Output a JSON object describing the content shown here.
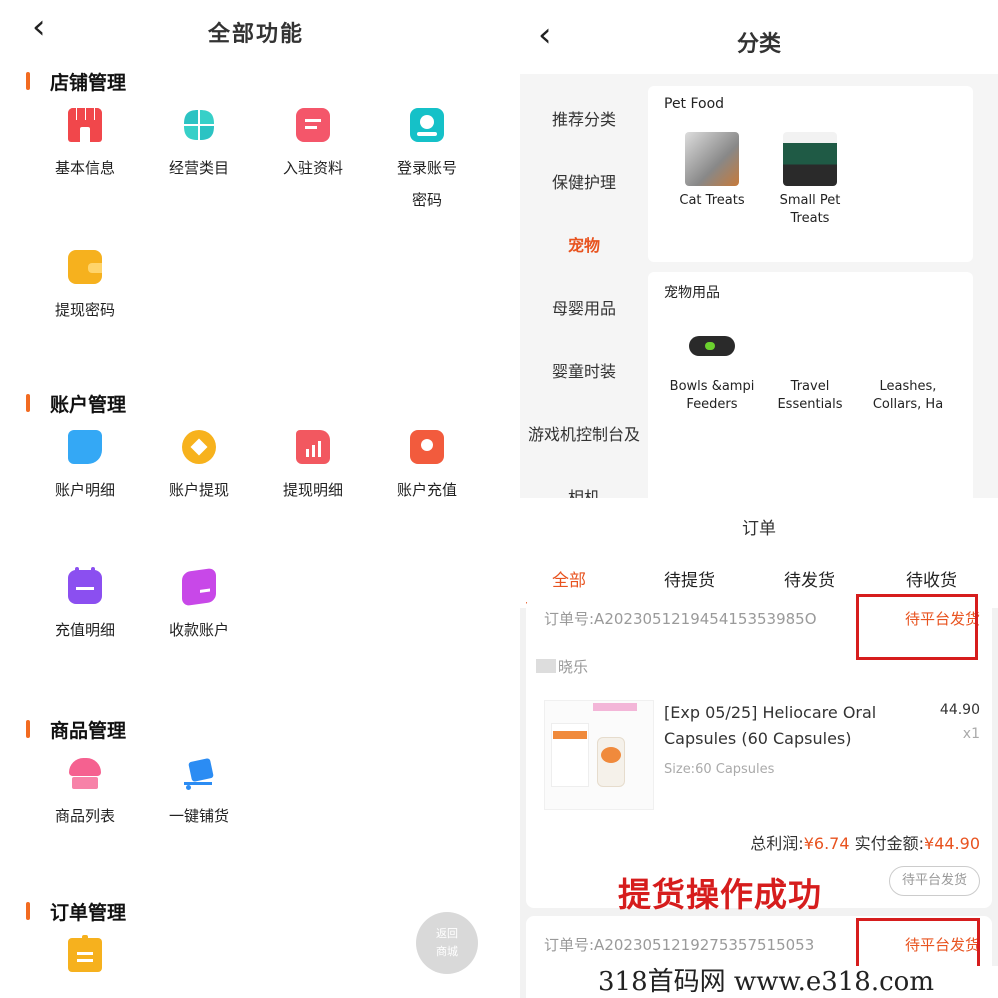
{
  "left": {
    "title": "全部功能",
    "back_icon": "chevron-left-icon",
    "return_button": {
      "line1": "返回",
      "line2": "商城"
    },
    "sections": [
      {
        "title": "店铺管理",
        "items": [
          {
            "label": "基本信息",
            "icon": "store-icon",
            "color": "#f1474b"
          },
          {
            "label": "经营类目",
            "icon": "category-icon",
            "color": "#2cc3c3"
          },
          {
            "label": "入驻资料",
            "icon": "document-icon",
            "color": "#f4566a"
          },
          {
            "label": "登录账号\n密码",
            "icon": "account-icon",
            "color": "#15c1c8"
          },
          {
            "label": "提现密码",
            "icon": "wallet-icon",
            "color": "#f6b11e"
          }
        ]
      },
      {
        "title": "账户管理",
        "items": [
          {
            "label": "账户明细",
            "icon": "account-detail-icon",
            "color": "#34a8f5"
          },
          {
            "label": "账户提现",
            "icon": "withdraw-icon",
            "color": "#f7b21d"
          },
          {
            "label": "提现明细",
            "icon": "folder-chart-icon",
            "color": "#f25860"
          },
          {
            "label": "账户充值",
            "icon": "recharge-icon",
            "color": "#f25b3d"
          },
          {
            "label": "充值明细",
            "icon": "calendar-icon",
            "color": "#8b4ff0"
          },
          {
            "label": "收款账户",
            "icon": "card-icon",
            "color": "#c848e8"
          }
        ]
      },
      {
        "title": "商品管理",
        "items": [
          {
            "label": "商品列表",
            "icon": "cake-icon",
            "color": "#f56190"
          },
          {
            "label": "一键铺货",
            "icon": "cart-box-icon",
            "color": "#2b8cf3"
          }
        ]
      },
      {
        "title": "订单管理",
        "items": [
          {
            "label": "",
            "icon": "clipboard-icon",
            "color": "#f6b11e"
          }
        ]
      }
    ]
  },
  "category": {
    "title": "分类",
    "sidebar": [
      "推荐分类",
      "保健护理",
      "宠物",
      "母婴用品",
      "婴童时装",
      "游戏机控制台及",
      "相机"
    ],
    "active": "宠物",
    "groups": [
      {
        "title": "Pet Food",
        "items": [
          "Cat Treats",
          "Small Pet\nTreats"
        ]
      },
      {
        "title": "宠物用品",
        "items": [
          "Bowls &ampi\nFeeders",
          "Travel\nEssentials",
          "Leashes,\nCollars, Ha"
        ]
      }
    ]
  },
  "orders": {
    "title": "订单",
    "tabs": [
      "全部",
      "待提货",
      "待发货",
      "待收货"
    ],
    "active_tab": "全部",
    "order1": {
      "number": "订单号:A202305121945415353985O",
      "status": "待平台发货",
      "shop": "晓乐",
      "product": "[Exp 05/25] Heliocare Oral Capsules (60 Capsules)",
      "size": "Size:60 Capsules",
      "price": "44.90",
      "qty": "x1",
      "profit_label": "总利润:",
      "profit": "¥6.74",
      "paid_label": "实付金额:",
      "paid": "¥44.90",
      "pill": "待平台发货"
    },
    "success_text": "提货操作成功",
    "order2": {
      "number": "订单号:A2023051219275357515053",
      "status": "待平台发货"
    }
  },
  "watermark": "318首码网  www.e318.com"
}
